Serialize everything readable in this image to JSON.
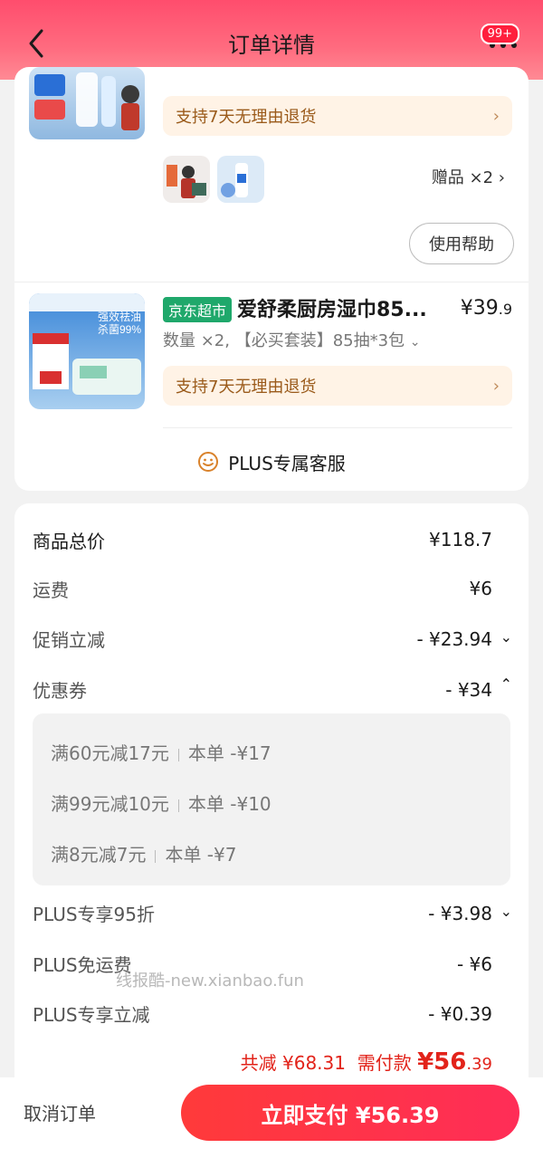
{
  "header": {
    "title": "订单详情",
    "badge": "99+"
  },
  "items": {
    "return_policy": "支持7天无理由退货",
    "gift_label": "赠品 ×2",
    "help_button": "使用帮助",
    "product2": {
      "store_tag": "京东超市",
      "title": "爱舒柔厨房湿巾85...",
      "price_int": "¥39",
      "price_dec": ".9",
      "spec": "数量 ×2, 【必买套装】85抽*3包"
    },
    "plus_service": "PLUS专属客服"
  },
  "price": {
    "subtotal_label": "商品总价",
    "subtotal_value": "¥118.7",
    "shipping_label": "运费",
    "shipping_value": "¥6",
    "promo_label": "促销立减",
    "promo_value": "- ¥23.94",
    "coupon_label": "优惠券",
    "coupon_value": "- ¥34",
    "coupons": [
      {
        "name": "满60元减17元",
        "detail": "本单 -¥17"
      },
      {
        "name": "满99元减10元",
        "detail": "本单 -¥10"
      },
      {
        "name": "满8元减7元",
        "detail": "本单 -¥7"
      }
    ],
    "plus95_label": "PLUS专享95折",
    "plus95_value": "- ¥3.98",
    "plus_free_ship_label": "PLUS免运费",
    "plus_free_ship_value": "- ¥6",
    "plus_discount_label": "PLUS专享立减",
    "plus_discount_value": "- ¥0.39",
    "total_discount": "共减 ¥68.31",
    "need_pay_label": "需付款",
    "need_pay_int": "¥56",
    "need_pay_dec": ".39"
  },
  "watermark": "线报酷-new.xianbao.fun",
  "footer": {
    "cancel": "取消订单",
    "pay": "立即支付 ¥56.39"
  },
  "colors": {
    "accent": "#ff2d3d",
    "return_bg": "#fff3e6",
    "jd_green": "#1fa86b"
  }
}
